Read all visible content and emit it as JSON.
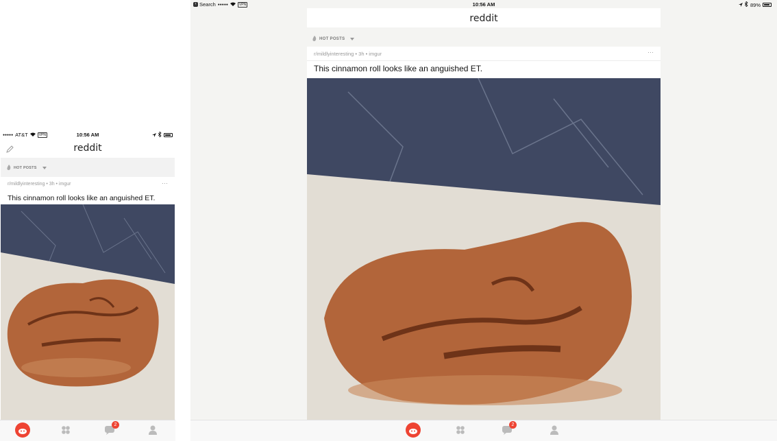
{
  "phone": {
    "status": {
      "carrier": "AT&T",
      "signal": "●●●●●",
      "vpn": "VPN",
      "time": "10:56 AM"
    },
    "app_title": "reddit",
    "sort_label": "HOT POSTS",
    "post": {
      "meta": "r/mildlyinteresting • 3h • imgur",
      "more": "···",
      "title": "This cinnamon roll looks like an anguished ET."
    },
    "tabs": {
      "inbox_badge": "2"
    }
  },
  "tablet": {
    "status": {
      "back_label": "Search",
      "signal": "●●●●●",
      "vpn": "VPN",
      "time": "10:56 AM",
      "battery": "89%"
    },
    "app_title": "reddit",
    "sort_label": "HOT POSTS",
    "post": {
      "meta": "r/mildlyinteresting • 3h • imgur",
      "more": "···",
      "title": "This cinnamon roll looks like an anguished ET."
    },
    "tabs": {
      "inbox_badge": "2"
    }
  },
  "colors": {
    "accent": "#ee4433",
    "marble": "#46506a",
    "napkin": "#e6e1d8",
    "pastry": "#b9683d"
  },
  "icons": [
    "pencil-icon",
    "flame-icon",
    "reddit-alien-icon",
    "communities-icon",
    "inbox-icon",
    "profile-icon",
    "wifi-icon",
    "bluetooth-icon",
    "location-icon"
  ]
}
